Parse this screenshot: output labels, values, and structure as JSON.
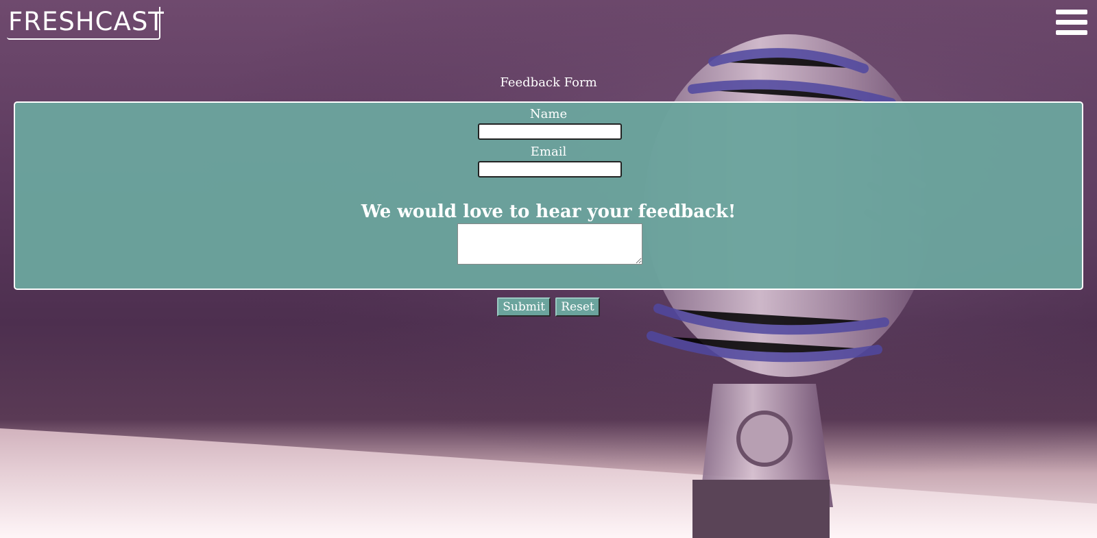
{
  "header": {
    "logo_text": "FRESHCAST",
    "menu_icon": "hamburger-menu-icon"
  },
  "form": {
    "title": "Feedback Form",
    "name_label": "Name",
    "name_value": "",
    "email_label": "Email",
    "email_value": "",
    "feedback_heading": "We would love to hear your feedback!",
    "feedback_value": "",
    "submit_label": "Submit",
    "reset_label": "Reset"
  },
  "colors": {
    "panel": "#6ba49d",
    "text": "#ffffff",
    "background": "#5c3a5e"
  }
}
